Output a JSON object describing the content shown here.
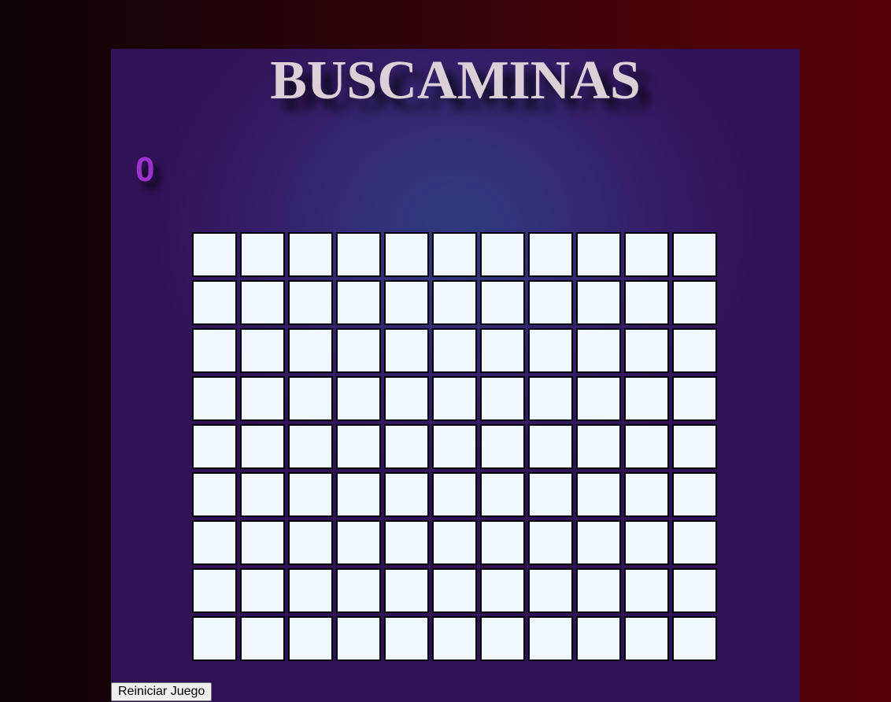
{
  "game": {
    "title": "BUSCAMINAS",
    "score": "0",
    "board": {
      "rows": 9,
      "columns": 11,
      "cell_state": "hidden"
    },
    "reset_label": "Reiniciar Juego"
  },
  "colors": {
    "background_left": "#0e0306",
    "background_right": "#560107",
    "panel": "#321257",
    "panel_glow": "#2f3a7e",
    "title": "#dcd0d8",
    "score": "#9933cc",
    "cell": "#f0f8ff",
    "cell_border": "#000000"
  }
}
